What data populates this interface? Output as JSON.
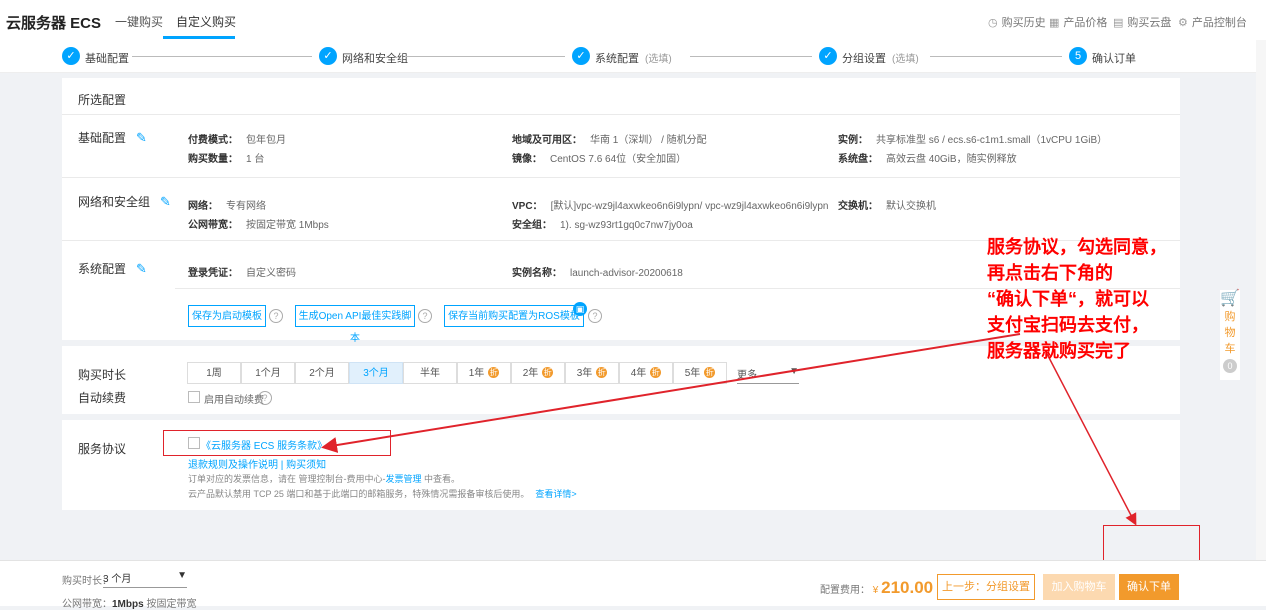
{
  "topbar": {
    "brand": "云服务器 ECS",
    "tab_quick": "一键购买",
    "tab_custom": "自定义购买",
    "right": [
      {
        "icon": "clock-icon",
        "glyph": "◷",
        "label": "购买历史"
      },
      {
        "icon": "table-icon",
        "glyph": "▦",
        "label": "产品价格"
      },
      {
        "icon": "disk-icon",
        "glyph": "▤",
        "label": "购买云盘"
      },
      {
        "icon": "gear-icon",
        "glyph": "⚙",
        "label": "产品控制台"
      }
    ]
  },
  "steps": [
    {
      "mark": "✓",
      "label": "基础配置",
      "opt": ""
    },
    {
      "mark": "✓",
      "label": "网络和安全组",
      "opt": ""
    },
    {
      "mark": "✓",
      "label": "系统配置",
      "opt": "(选填)"
    },
    {
      "mark": "✓",
      "label": "分组设置",
      "opt": "(选填)"
    },
    {
      "mark": "5",
      "label": "确认订单",
      "opt": ""
    }
  ],
  "selected": {
    "title": "所选配置",
    "basic": {
      "title": "基础配置",
      "billing_k": "付费模式：",
      "billing_v": "包年包月",
      "region_k": "地域及可用区：",
      "region_v": "华南 1（深圳） / 随机分配",
      "instance_k": "实例：",
      "instance_v": "共享标准型 s6 / ecs.s6-c1m1.small（1vCPU 1GiB）",
      "qty_k": "购买数量：",
      "qty_v": "1 台",
      "image_k": "镜像：",
      "image_v": "CentOS 7.6 64位（安全加固）",
      "disk_k": "系统盘：",
      "disk_v": "高效云盘 40GiB，随实例释放"
    },
    "network": {
      "title": "网络和安全组",
      "net_k": "网络：",
      "net_v": "专有网络",
      "vpc_k": "VPC：",
      "vpc_v": "[默认]vpc-wz9jl4axwkeo6n6i9lypn/ vpc-wz9jl4axwkeo6n6i9lypn",
      "switch_k": "交换机：",
      "switch_v": "默认交换机",
      "bw_k": "公网带宽：",
      "bw_v": "按固定带宽 1Mbps",
      "sg_k": "安全组：",
      "sg_v": "1). sg-wz93rt1gq0c7nw7jy0oa"
    },
    "system": {
      "title": "系统配置",
      "login_k": "登录凭证：",
      "login_v": "自定义密码",
      "name_k": "实例名称：",
      "name_v": "launch-advisor-20200618"
    },
    "buttons": {
      "save_template": "保存为启动模板",
      "gen_api": "生成Open API最佳实践脚本",
      "save_ros": "保存当前购买配置为ROS模板"
    }
  },
  "duration": {
    "label": "购买时长",
    "options": [
      {
        "label": "1周",
        "promo": false
      },
      {
        "label": "1个月",
        "promo": false
      },
      {
        "label": "2个月",
        "promo": false
      },
      {
        "label": "3个月",
        "promo": false,
        "selected": true
      },
      {
        "label": "半年",
        "promo": false
      },
      {
        "label": "1年",
        "promo": true
      },
      {
        "label": "2年",
        "promo": true
      },
      {
        "label": "3年",
        "promo": true
      },
      {
        "label": "4年",
        "promo": true
      },
      {
        "label": "5年",
        "promo": true
      }
    ],
    "promo_glyph": "折",
    "more": "更多",
    "auto_renew_label": "自动续费",
    "auto_renew_option": "启用自动续费"
  },
  "agreement": {
    "label": "服务协议",
    "terms": "《云服务器 ECS 服务条款》",
    "line1": "退款规则及操作说明 | 购买须知",
    "line2_a": "订单对应的发票信息，请在 管理控制台-费用中心-",
    "line2_link": "发票管理",
    "line2_b": " 中查看。",
    "line3_a": "云产品默认禁用 TCP 25 端口和基于此端口的邮箱服务，特殊情况需报备审核后使用。",
    "line3_link": "查看详情>"
  },
  "annotation": {
    "l1": "服务协议，勾选同意，",
    "l2": "再点击右下角的",
    "l3": "“确认下单“，就可以",
    "l4": "支付宝扫码去支付，",
    "l5": "服务器就购买完了"
  },
  "cart": {
    "label_1": "购",
    "label_2": "物",
    "label_3": "车",
    "count": "0"
  },
  "bottom": {
    "duration_label": "购买时长：",
    "duration_value": "3 个月",
    "bandwidth_label": "公网带宽：",
    "bandwidth_value": "1Mbps",
    "bandwidth_note": "按固定带宽",
    "price_label": "配置费用：",
    "currency": "¥",
    "price": "210.00",
    "prev": "上一步：分组设置",
    "add_cart": "加入购物车",
    "confirm": "确认下单"
  },
  "colors": {
    "accent": "#00a4ff",
    "orange": "#f29a2c",
    "annotation": "#ff0000"
  }
}
